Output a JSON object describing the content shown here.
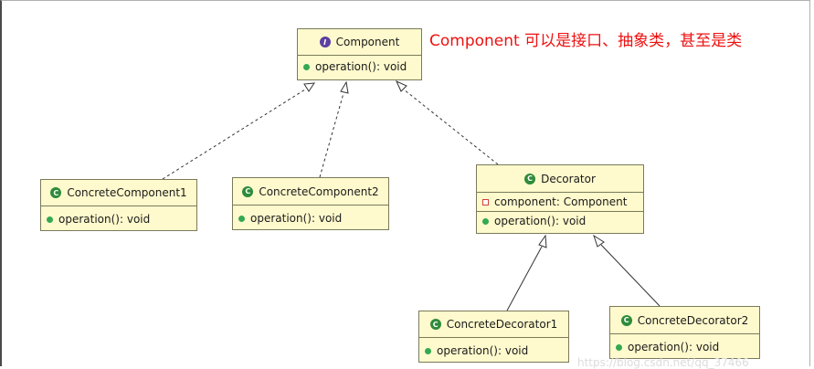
{
  "annotation": "Component 可以是接口、抽象类，甚至是类",
  "watermark": "https://blog.csdn.net/qq_37466",
  "badges": {
    "interface": "I",
    "class": "C"
  },
  "classes": {
    "component": {
      "name": "Component",
      "kind": "interface",
      "methods": [
        "operation(): void"
      ]
    },
    "concrete_component_1": {
      "name": "ConcreteComponent1",
      "kind": "class",
      "methods": [
        "operation(): void"
      ]
    },
    "concrete_component_2": {
      "name": "ConcreteComponent2",
      "kind": "class",
      "methods": [
        "operation(): void"
      ]
    },
    "decorator": {
      "name": "Decorator",
      "kind": "class",
      "fields": [
        "component: Component"
      ],
      "methods": [
        "operation(): void"
      ]
    },
    "concrete_decorator_1": {
      "name": "ConcreteDecorator1",
      "kind": "class",
      "methods": [
        "operation(): void"
      ]
    },
    "concrete_decorator_2": {
      "name": "ConcreteDecorator2",
      "kind": "class",
      "methods": [
        "operation(): void"
      ]
    }
  },
  "relations": [
    {
      "from": "ConcreteComponent1",
      "to": "Component",
      "type": "realization"
    },
    {
      "from": "ConcreteComponent2",
      "to": "Component",
      "type": "realization"
    },
    {
      "from": "Decorator",
      "to": "Component",
      "type": "realization"
    },
    {
      "from": "ConcreteDecorator1",
      "to": "Decorator",
      "type": "generalization"
    },
    {
      "from": "ConcreteDecorator2",
      "to": "Decorator",
      "type": "generalization"
    }
  ],
  "colors": {
    "class_fill": "#fffacd",
    "class_border": "#7a7a5a",
    "annotation": "#ee1111",
    "class_badge": "#2e8b3a",
    "interface_badge": "#5b3fa0"
  }
}
